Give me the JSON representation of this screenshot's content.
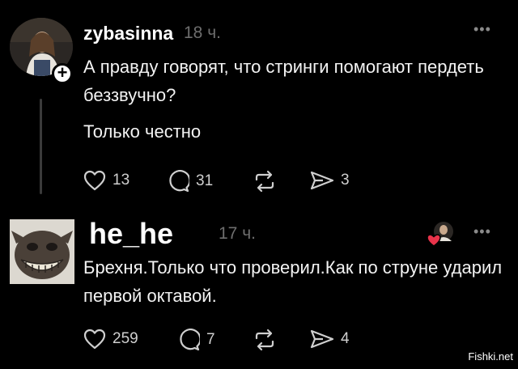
{
  "posts": [
    {
      "username": "zybasinna",
      "time": "18 ч.",
      "text_lines": [
        "А правду говорят, что стринги помогают пердеть беззвучно?",
        "Только честно"
      ],
      "likes": "13",
      "replies": "31",
      "shares": "3",
      "more_icon": "more-icon",
      "follow_icon": "plus-icon"
    },
    {
      "username": "he_he",
      "time": "17 ч.",
      "text": "Брехня.Только что проверил.Как по струне ударил первой октавой.",
      "likes": "259",
      "replies": "7",
      "shares": "4",
      "more_icon": "more-icon",
      "liked_by_icon": "heart-badge-icon"
    }
  ],
  "icons": {
    "like": "heart-icon",
    "reply": "comment-icon",
    "repost": "repost-icon",
    "share": "send-icon"
  },
  "colors": {
    "background": "#000000",
    "text": "#f3f3f3",
    "muted": "#6e6e6e",
    "heart_badge": "#e8334a"
  },
  "watermark": "Fishki.net"
}
